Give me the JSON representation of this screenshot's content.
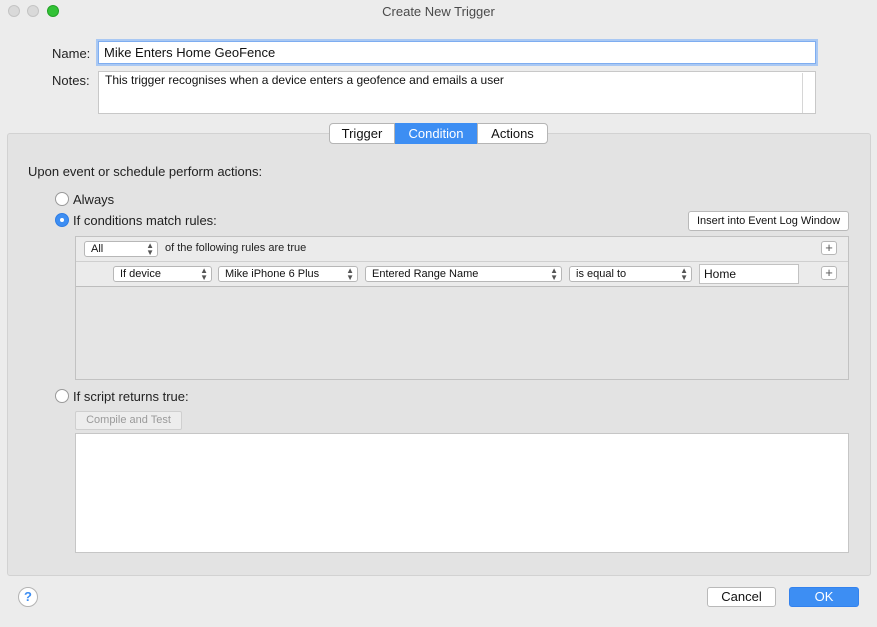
{
  "window": {
    "title": "Create New Trigger"
  },
  "form": {
    "name_label": "Name:",
    "name_value": "Mike Enters Home GeoFence",
    "notes_label": "Notes:",
    "notes_value": "This trigger recognises when a device enters a geofence and emails a user"
  },
  "tabs": [
    {
      "label": "Trigger",
      "selected": false
    },
    {
      "label": "Condition",
      "selected": true
    },
    {
      "label": "Actions",
      "selected": false
    }
  ],
  "condition": {
    "heading": "Upon event or schedule perform actions:",
    "options": [
      {
        "label": "Always",
        "selected": false
      },
      {
        "label": "If conditions match rules:",
        "selected": true
      },
      {
        "label": "If script returns true:",
        "selected": false
      }
    ],
    "insert_button": "Insert into Event Log Window",
    "rules": {
      "match_selector": "All",
      "match_suffix": "of the following rules are true",
      "row": {
        "subject": "If device",
        "device": "Mike iPhone 6 Plus",
        "property": "Entered Range Name",
        "operator": "is equal to",
        "value": "Home"
      },
      "add_symbol": "+"
    },
    "compile_button": "Compile and Test"
  },
  "footer": {
    "help_symbol": "?",
    "cancel": "Cancel",
    "ok": "OK"
  },
  "colors": {
    "accent": "#3d8ef3",
    "window_bg": "#ececec"
  },
  "icons": {
    "help": "question-mark-icon",
    "add": "plus-icon",
    "popup": "updown-arrows-icon"
  }
}
